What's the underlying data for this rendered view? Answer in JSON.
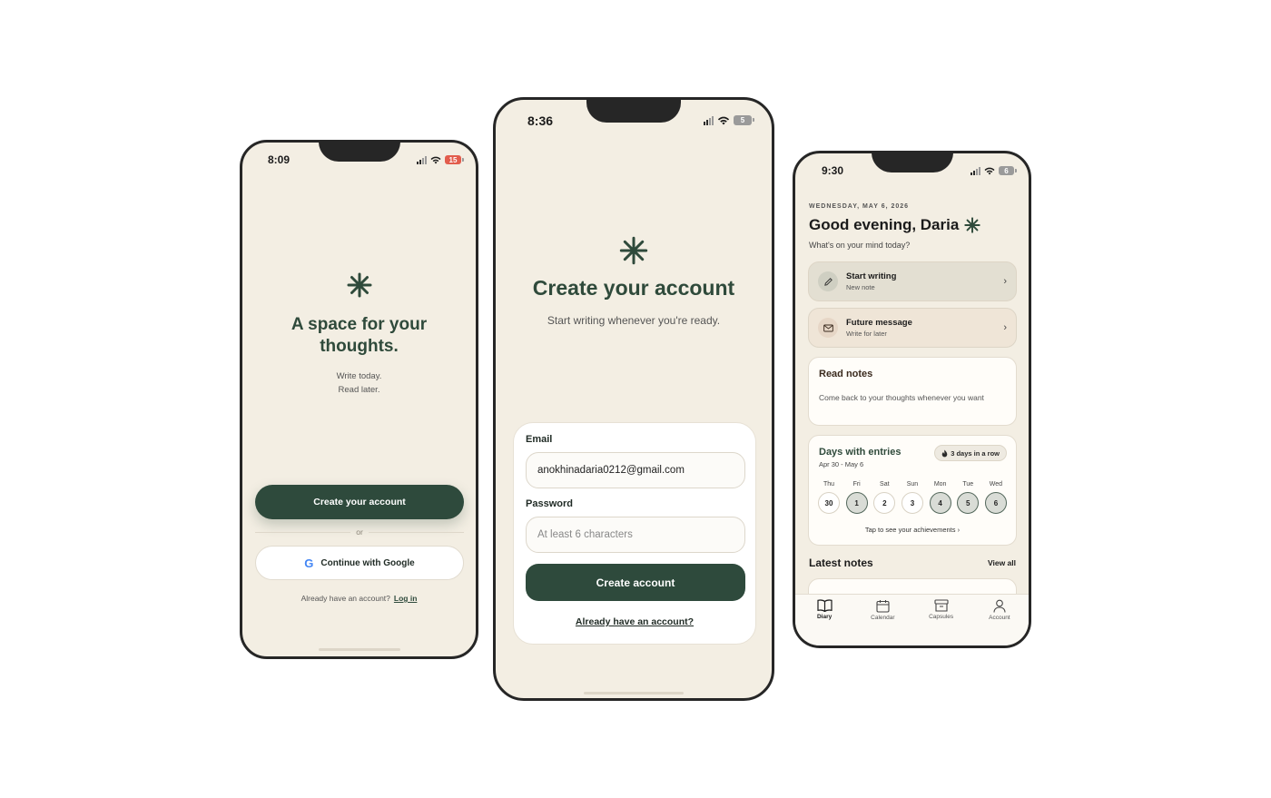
{
  "colors": {
    "brand_green": "#2e4a3c",
    "phone_bg": "#f3eee3",
    "battery_red": "#e25d4d",
    "battery_gray": "#9a9a9a"
  },
  "screen_welcome": {
    "status": {
      "time": "8:09",
      "battery": "15"
    },
    "logo_icon": "asterisk-icon",
    "title": "A space for your thoughts.",
    "subtitle_line1": "Write today.",
    "subtitle_line2": "Read later.",
    "create_button": "Create your account",
    "or_text": "or",
    "google_button": "Continue with Google",
    "google_icon": "G",
    "login_prompt": "Already have an account?",
    "login_link": "Log in"
  },
  "screen_signup": {
    "status": {
      "time": "8:36",
      "battery": "5"
    },
    "logo_icon": "asterisk-icon",
    "title": "Create your account",
    "subtitle": "Start writing whenever you're ready.",
    "email_label": "Email",
    "email_value": "anokhinadaria0212@gmail.com",
    "password_label": "Password",
    "password_placeholder": "At least 6 characters",
    "submit_button": "Create account",
    "login_link": "Already have an account?"
  },
  "screen_diary": {
    "status": {
      "time": "9:30",
      "battery": "6"
    },
    "date": "WEDNESDAY, MAY 6, 2026",
    "greeting": "Good evening, Daria",
    "prompt": "What's on your mind today?",
    "actions": [
      {
        "title": "Start writing",
        "subtitle": "New note",
        "icon": "pencil-icon"
      },
      {
        "title": "Future message",
        "subtitle": "Write for later",
        "icon": "envelope-icon"
      }
    ],
    "read_notes": {
      "title": "Read notes",
      "description": "Come back to your thoughts whenever you want"
    },
    "days_with_entries": {
      "title": "Days with entries",
      "range": "Apr 30 - May 6",
      "streak": "3 days in a row",
      "streak_icon": "flame-icon",
      "days": [
        {
          "name": "Thu",
          "num": "30",
          "active": false
        },
        {
          "name": "Fri",
          "num": "1",
          "active": true
        },
        {
          "name": "Sat",
          "num": "2",
          "active": false
        },
        {
          "name": "Sun",
          "num": "3",
          "active": false
        },
        {
          "name": "Mon",
          "num": "4",
          "active": true
        },
        {
          "name": "Tue",
          "num": "5",
          "active": true
        },
        {
          "name": "Wed",
          "num": "6",
          "active": true
        }
      ],
      "achievements_link": "Tap to see your achievements"
    },
    "latest_notes_title": "Latest notes",
    "view_all": "View all",
    "nav": [
      {
        "label": "Diary",
        "icon": "book-icon",
        "active": true
      },
      {
        "label": "Calendar",
        "icon": "calendar-icon",
        "active": false
      },
      {
        "label": "Capsules",
        "icon": "archive-icon",
        "active": false
      },
      {
        "label": "Account",
        "icon": "person-icon",
        "active": false
      }
    ]
  }
}
